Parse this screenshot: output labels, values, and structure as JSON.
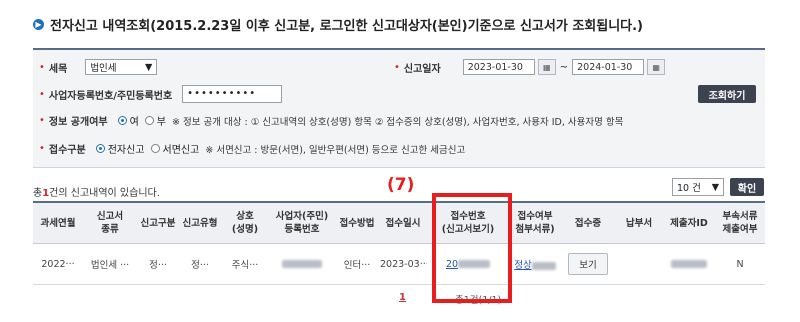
{
  "title": "전자신고 내역조회(2015.2.23일 이후 신고분, 로그인한 신고대상자(본인)기준으로 신고서가 조회됩니다.)",
  "search": {
    "tax_label": "세목",
    "tax_value": "법인세",
    "date_label": "신고일자",
    "date_from": "2023-01-30",
    "date_to": "2024-01-30",
    "date_sep": "~",
    "bizno_label": "사업자등록번호/주민등록번호",
    "bizno_value": "••••••••••",
    "search_button": "조회하기",
    "disclose_label": "정보 공개여부",
    "disclose_yes": "여",
    "disclose_no": "부",
    "disclose_note": "※ 정보 공개 대상 : ① 신고내역의 상호(성명) 항목 ② 접수증의 상호(성명), 사업자번호, 사용자 ID, 사용자명 항목",
    "receipt_label": "접수구분",
    "receipt_electronic": "전자신고",
    "receipt_paper": "서면신고",
    "receipt_note": "※ 서면신고 : 방문(서면), 일반우편(서면) 등으로 신고한 세금신고"
  },
  "result": {
    "count_prefix": "총",
    "count_number": "1",
    "count_suffix": "건의 신고내역이 있습니다.",
    "page_size": "10 건",
    "confirm_button": "확인"
  },
  "table": {
    "headers": [
      "과세연월",
      "신고서\n종류",
      "신고구분",
      "신고유형",
      "상호\n(성명)",
      "사업자(주민)\n등록번호",
      "접수방법",
      "접수일시",
      "접수번호\n(신고서보기)",
      "접수여부\n첨부서류)",
      "접수증",
      "납부서",
      "제출자ID",
      "부속서류\n제출여부"
    ],
    "row": {
      "period": "2022···",
      "form_type": "법인세 ···",
      "category": "정···",
      "filing_type": "정···",
      "name": "주식···",
      "method": "인터···",
      "received_at": "2023-03···",
      "receipt_no_prefix": "20",
      "status_prefix": "정상",
      "receipt_button": "보기",
      "attached": "N"
    }
  },
  "pager": {
    "current_page": "1",
    "info": "총1건(1/1)"
  },
  "annotation": {
    "label": "(7)",
    "color": "#e81e1e"
  }
}
